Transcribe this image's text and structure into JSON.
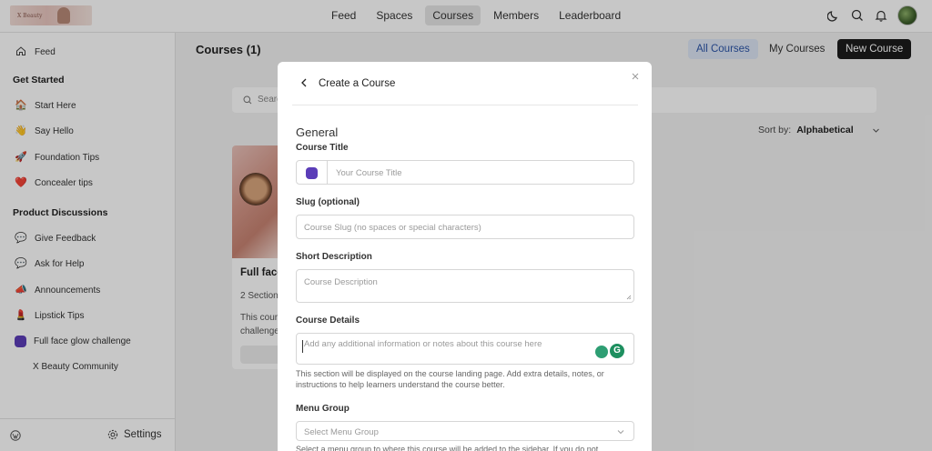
{
  "topnav": {
    "logo_text": "X Beauty",
    "items": [
      "Feed",
      "Spaces",
      "Courses",
      "Members",
      "Leaderboard"
    ],
    "active": "Courses",
    "icons": [
      "moon-icon",
      "search-icon",
      "bell-icon",
      "avatar"
    ]
  },
  "sidebar": {
    "feed": "Feed",
    "get_started_title": "Get Started",
    "get_started_items": [
      {
        "label": "Start Here",
        "icon": "🏠"
      },
      {
        "label": "Say Hello",
        "icon": "👋"
      },
      {
        "label": "Foundation Tips",
        "icon": "🚀"
      },
      {
        "label": "Concealer tips",
        "icon": "❤️"
      }
    ],
    "discussions_title": "Product Discussions",
    "discussion_items": [
      {
        "label": "Give Feedback",
        "icon": "💬"
      },
      {
        "label": "Ask for Help",
        "icon": "💬"
      },
      {
        "label": "Announcements",
        "icon": "📣"
      },
      {
        "label": "Lipstick Tips",
        "icon": "💄"
      },
      {
        "label": "Full face glow challenge",
        "icon": "purple-square"
      },
      {
        "label": "X Beauty Community",
        "icon": ""
      }
    ],
    "settings": "Settings"
  },
  "main": {
    "title": "Courses (1)",
    "tabs": [
      "All Courses",
      "My Courses"
    ],
    "new_course": "New Course",
    "search_placeholder": "Search",
    "sort_label": "Sort by:",
    "sort_value": "Alphabetical",
    "card": {
      "title": "Full face",
      "sections": "2 Section",
      "desc1": "This cour",
      "desc2": "challenge"
    }
  },
  "modal": {
    "title": "Create a Course",
    "section": "General",
    "course_title_label": "Course Title",
    "course_title_placeholder": "Your Course Title",
    "slug_label": "Slug (optional)",
    "slug_placeholder": "Course Slug (no spaces or special characters)",
    "short_desc_label": "Short Description",
    "short_desc_placeholder": "Course Description",
    "details_label": "Course Details",
    "details_placeholder": "Add any additional information or notes about this course here",
    "details_help": "This section will be displayed on the course landing page. Add extra details, notes, or instructions to help learners understand the course better.",
    "menu_group_label": "Menu Group",
    "menu_group_placeholder": "Select Menu Group",
    "menu_group_help": "Select a menu group to where this course will be added to the sidebar. If you do not"
  },
  "colors": {
    "accent_purple": "#5b3db8",
    "tab_active_bg": "#dde6f5",
    "tab_active_text": "#2c55a8",
    "button_dark": "#1c1c1c"
  }
}
